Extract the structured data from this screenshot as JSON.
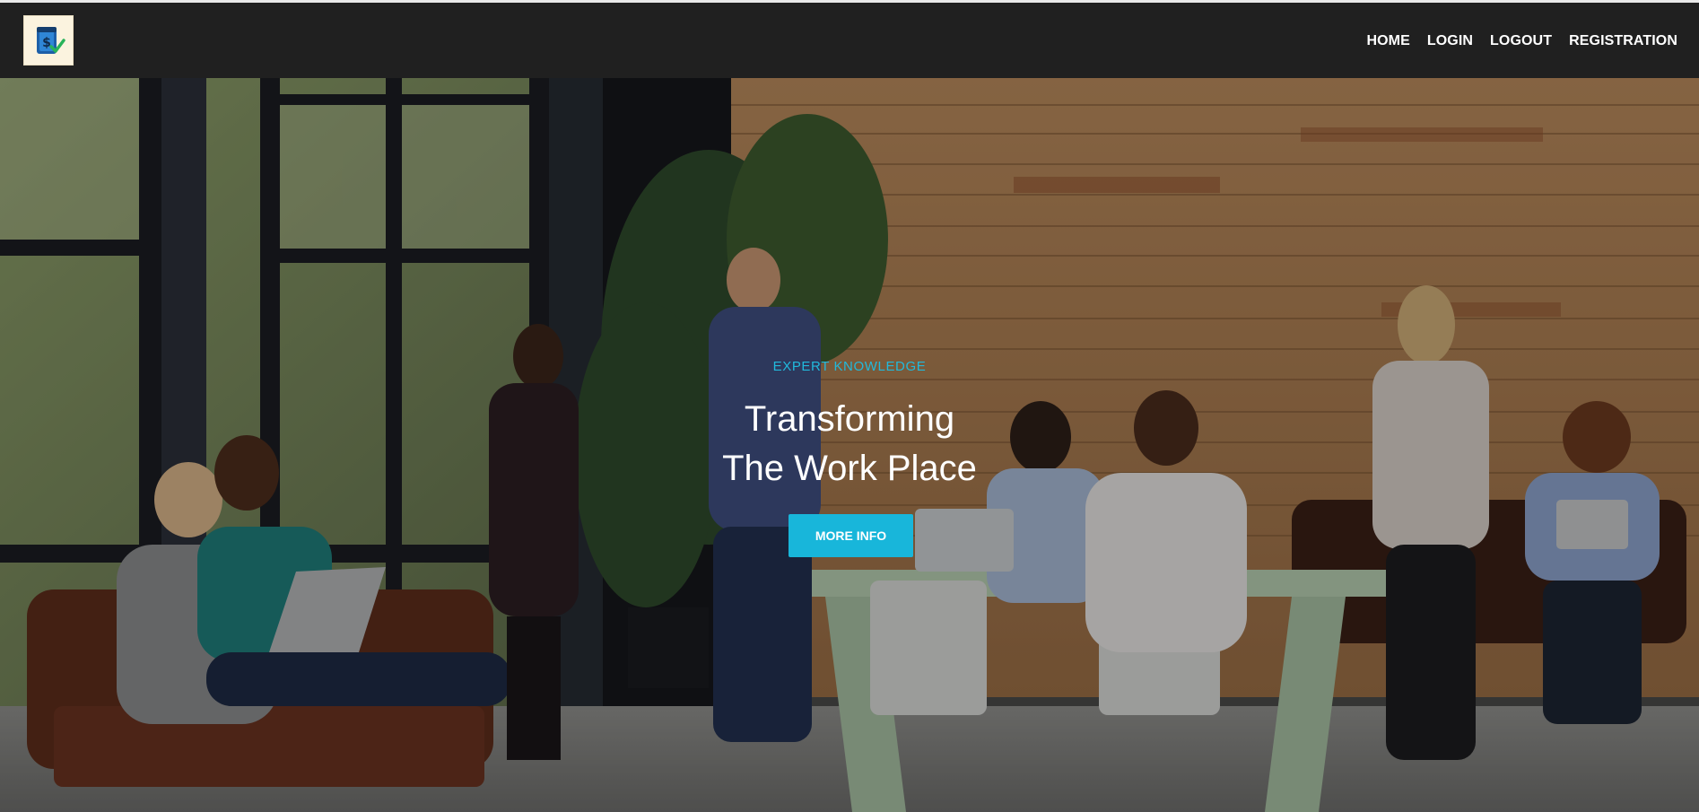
{
  "brand": {
    "logo_icon": "dollar-document-check-icon"
  },
  "nav": {
    "items": [
      {
        "label": "HOME"
      },
      {
        "label": "LOGIN"
      },
      {
        "label": "LOGOUT"
      },
      {
        "label": "REGISTRATION"
      }
    ]
  },
  "hero": {
    "eyebrow": "EXPERT KNOWLEDGE",
    "headline_line1": "Transforming",
    "headline_line2": "The Work Place",
    "cta_label": "MORE INFO",
    "background": "office-team-photo"
  },
  "colors": {
    "navbar_bg": "#202020",
    "accent": "#18b6da",
    "eyebrow": "#21b9dc",
    "headline": "#ffffff"
  }
}
